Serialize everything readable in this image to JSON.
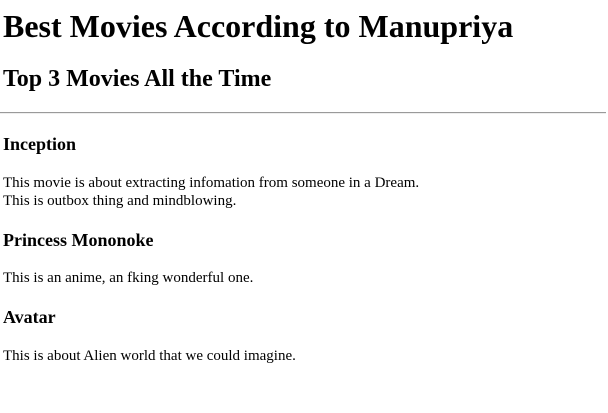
{
  "page": {
    "title": "Best Movies According to Manupriya",
    "subtitle": "Top 3 Movies All the Time"
  },
  "movies": [
    {
      "title": "Inception",
      "description_lines": [
        "This movie is about extracting infomation from someone in a Dream.",
        "This is outbox thing and mindblowing."
      ]
    },
    {
      "title": "Princess Mononoke",
      "description_lines": [
        "This is an anime, an fking wonderful one."
      ]
    },
    {
      "title": "Avatar",
      "description_lines": [
        "This is about Alien world that we could imagine."
      ]
    }
  ]
}
